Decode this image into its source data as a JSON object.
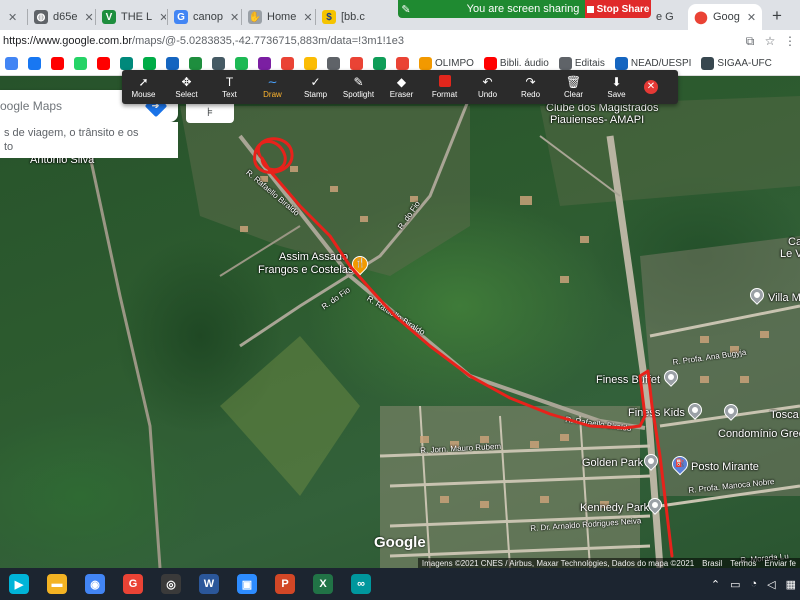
{
  "browser": {
    "tabs": [
      {
        "label": "×",
        "icon": "tab-icon-generic",
        "color": "#5f6368"
      },
      {
        "label": "d65e",
        "icon": "globe-icon",
        "color": "#5f6368"
      },
      {
        "label": "THE L",
        "icon": "v-logo-icon",
        "color": "#1e8e3e"
      },
      {
        "label": "canop",
        "icon": "google-g-icon",
        "color": "#4285f4"
      },
      {
        "label": "Home",
        "icon": "hand-icon",
        "color": "#5f6368"
      },
      {
        "label": "[bb.c",
        "icon": "bank-icon",
        "color": "#f5c400"
      },
      {
        "label": "e G",
        "icon": "tab-icon-generic",
        "color": "#5f6368"
      },
      {
        "label": "Goog",
        "icon": "maps-pin-icon",
        "color": "#ea4335"
      }
    ],
    "new_tab_label": "+",
    "url_host": "https://www.google.com.br",
    "url_rest": "/maps/@-5.0283835,-42.7736715,883m/data=!3m1!1e3"
  },
  "share": {
    "text": "You are screen sharing",
    "stop_label": "Stop Share"
  },
  "bookmarks": [
    {
      "label": "",
      "icon": "google-icon",
      "color": "#4285f4"
    },
    {
      "label": "",
      "icon": "facebook-icon",
      "color": "#1877f2"
    },
    {
      "label": "",
      "icon": "youtube-icon",
      "color": "#ff0000"
    },
    {
      "label": "",
      "icon": "whatsapp-icon",
      "color": "#25d366"
    },
    {
      "label": "",
      "icon": "youtube-icon",
      "color": "#ff0000"
    },
    {
      "label": "",
      "icon": "app-icon",
      "color": "#00897b"
    },
    {
      "label": "",
      "icon": "meet-icon",
      "color": "#00ac47"
    },
    {
      "label": "",
      "icon": "app-icon",
      "color": "#1565c0"
    },
    {
      "label": "",
      "icon": "app-icon",
      "color": "#1e8e3e"
    },
    {
      "label": "",
      "icon": "app-icon",
      "color": "#455a64"
    },
    {
      "label": "",
      "icon": "spotify-icon",
      "color": "#1db954"
    },
    {
      "label": "",
      "icon": "app-icon",
      "color": "#7b1fa2"
    },
    {
      "label": "",
      "icon": "google-icon",
      "color": "#ea4335"
    },
    {
      "label": "",
      "icon": "app-icon",
      "color": "#fbbc04"
    },
    {
      "label": "",
      "icon": "app-icon",
      "color": "#5f6368"
    },
    {
      "label": "",
      "icon": "app-icon",
      "color": "#ea4335"
    },
    {
      "label": "",
      "icon": "app-icon",
      "color": "#0f9d58"
    },
    {
      "label": "",
      "icon": "app-icon",
      "color": "#ea4335"
    },
    {
      "label": "OLIMPO",
      "icon": "trident-icon",
      "color": "#f29900"
    },
    {
      "label": "Bibli. áudio",
      "icon": "youtube-icon",
      "color": "#ff0000"
    },
    {
      "label": "Editais",
      "icon": "app-icon",
      "color": "#5f6368"
    },
    {
      "label": "NEAD/UESPI",
      "icon": "app-icon",
      "color": "#1565c0"
    },
    {
      "label": "SIGAA-UFC",
      "icon": "app-icon",
      "color": "#37474f"
    }
  ],
  "annotate_tools": [
    {
      "label": "Mouse",
      "icon": "cursor-icon",
      "glyph": "➚"
    },
    {
      "label": "Select",
      "icon": "move-icon",
      "glyph": "✥"
    },
    {
      "label": "Text",
      "icon": "text-icon",
      "glyph": "T"
    },
    {
      "label": "Draw",
      "icon": "draw-icon",
      "glyph": "∼",
      "active": true
    },
    {
      "label": "Stamp",
      "icon": "checkmark-icon",
      "glyph": "✓"
    },
    {
      "label": "Spotlight",
      "icon": "spotlight-icon",
      "glyph": "✎"
    },
    {
      "label": "Eraser",
      "icon": "eraser-icon",
      "glyph": "◆"
    },
    {
      "label": "Format",
      "icon": "color-swatch-icon",
      "glyph": ""
    },
    {
      "label": "Undo",
      "icon": "undo-icon",
      "glyph": "↶"
    },
    {
      "label": "Redo",
      "icon": "redo-icon",
      "glyph": "↷"
    },
    {
      "label": "Clear",
      "icon": "trash-icon",
      "glyph": "🗑"
    },
    {
      "label": "Save",
      "icon": "save-icon",
      "glyph": "⬇"
    }
  ],
  "maps": {
    "search_placeholder": "oogle Maps",
    "suggestion_line1": "s de viagem, o trânsito e os",
    "suggestion_line2": "to",
    "place_labels": [
      {
        "text": "Antônio Silva"
      },
      {
        "text": "Clube dos Magistrados"
      },
      {
        "text": "Piauienses- AMAPI"
      },
      {
        "text": "Assim Assado"
      },
      {
        "text": "Frangos e Costelas"
      },
      {
        "text": "Finess Buffet"
      },
      {
        "text": "Finess Kids"
      },
      {
        "text": "Condomínio Green"
      },
      {
        "text": "Golden Park"
      },
      {
        "text": "Posto Mirante"
      },
      {
        "text": "Kennedy Park"
      },
      {
        "text": "Villa M"
      },
      {
        "text": "Tosca"
      },
      {
        "text": "Cas"
      },
      {
        "text": "Le V"
      }
    ],
    "street_labels": [
      {
        "text": "R. Rafaello Biraldo"
      },
      {
        "text": "R. do Fio"
      },
      {
        "text": "R. do Fio"
      },
      {
        "text": "R. Rafaello Biraldo"
      },
      {
        "text": "R. Rafaello Biraldo"
      },
      {
        "text": "R. Profa. Ana Bugyja"
      },
      {
        "text": "R. Jorn. Mauro Rubem"
      },
      {
        "text": "R. Profa. Manoca Nobre"
      },
      {
        "text": "R. Dr. Arnaldo Rodrigues Neiva"
      },
      {
        "text": "R. Morada Lu"
      }
    ],
    "logo": "Google",
    "attribution": "Imagens ©2021 CNES / Airbus, Maxar Technologies, Dados do mapa ©2021",
    "attribution_links": [
      "Brasil",
      "Termos",
      "Enviar fe"
    ],
    "route_color": "#e8221b"
  },
  "taskbar": {
    "apps": [
      {
        "icon": "play-icon",
        "color": "#00b4d8",
        "glyph": "▶"
      },
      {
        "icon": "file-explorer-icon",
        "color": "#f3b323",
        "glyph": "▬"
      },
      {
        "icon": "chrome-icon",
        "color": "#4285f4",
        "glyph": "◉"
      },
      {
        "icon": "google-icon",
        "color": "#ea4335",
        "glyph": "G"
      },
      {
        "icon": "obs-icon",
        "color": "#3a3a3a",
        "glyph": "◎"
      },
      {
        "icon": "word-icon",
        "color": "#2b579a",
        "glyph": "W"
      },
      {
        "icon": "zoom-icon",
        "color": "#2d8cff",
        "glyph": "▣"
      },
      {
        "icon": "powerpoint-icon",
        "color": "#d24726",
        "glyph": "P"
      },
      {
        "icon": "excel-icon",
        "color": "#217346",
        "glyph": "X"
      },
      {
        "icon": "arduino-icon",
        "color": "#00979d",
        "glyph": "∞"
      }
    ]
  }
}
